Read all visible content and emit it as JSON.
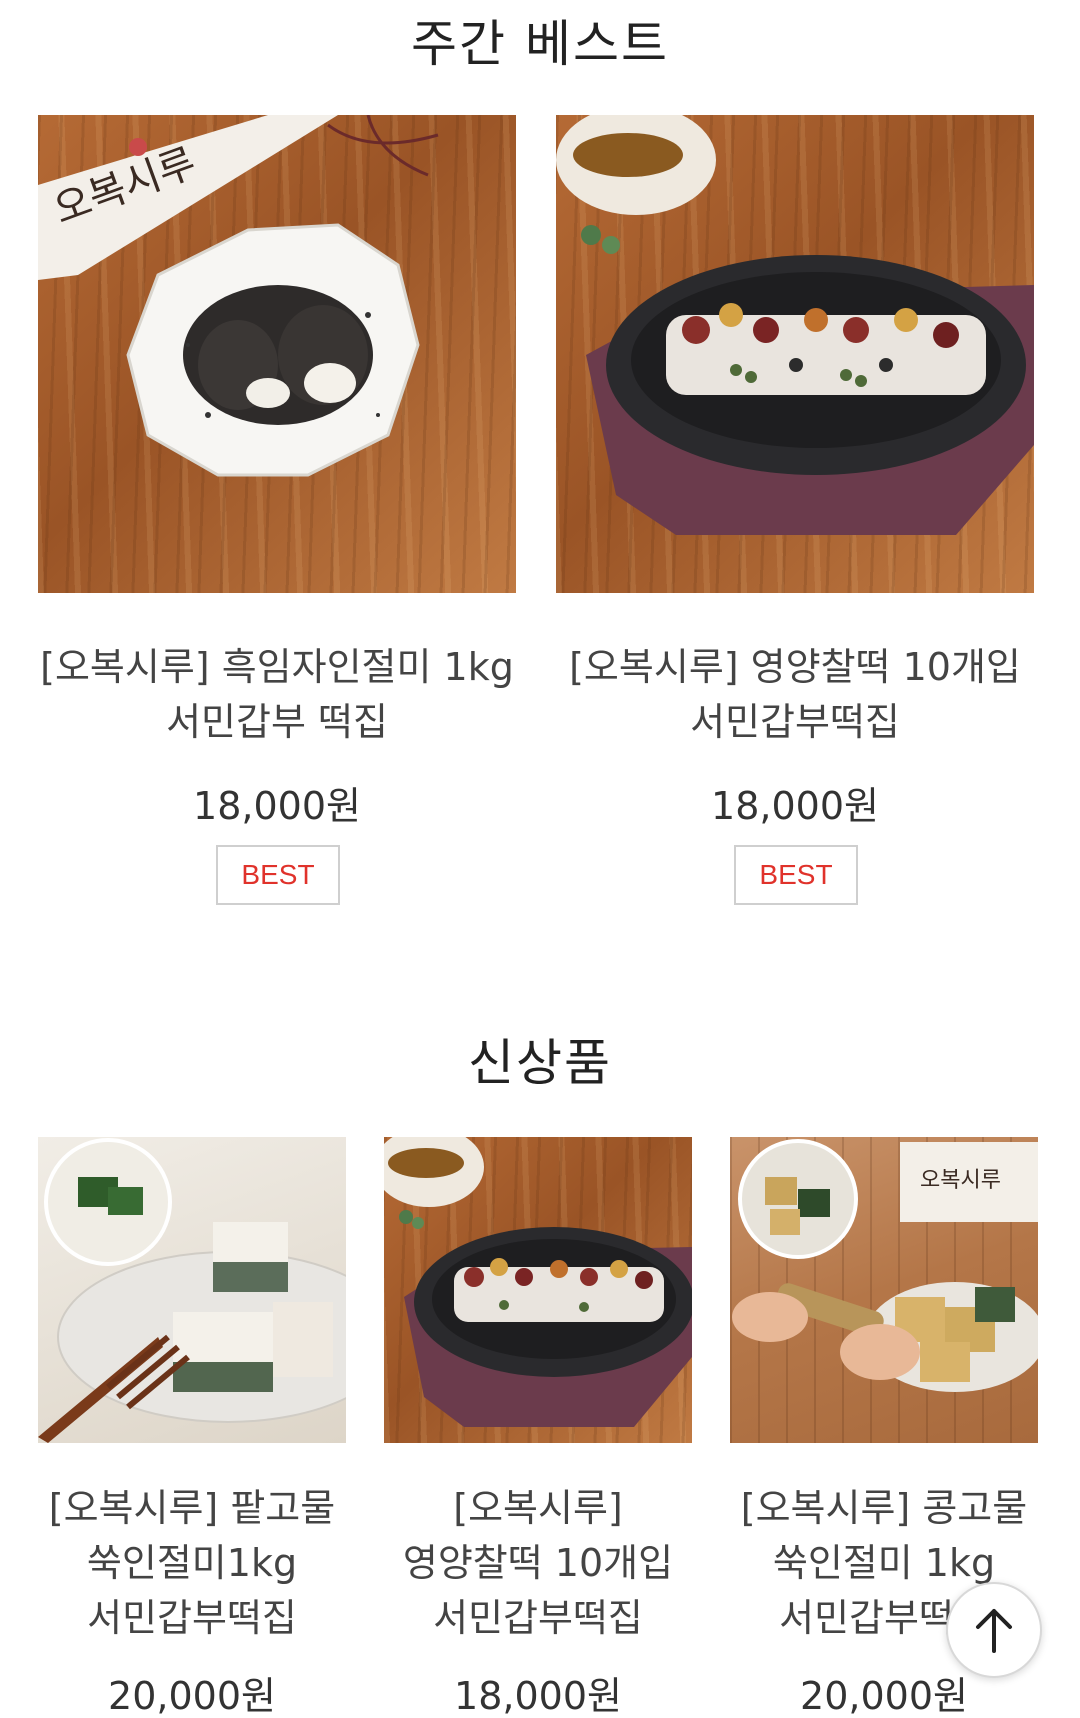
{
  "weekly_best": {
    "title": "주간 베스트",
    "items": [
      {
        "name_line1": "[오복시루] 흑임자인절미 1kg",
        "name_line2": "서민갑부 떡집",
        "price": "18,000원",
        "badge": "BEST"
      },
      {
        "name_line1": "[오복시루] 영양찰떡 10개입",
        "name_line2": "서민갑부떡집",
        "price": "18,000원",
        "badge": "BEST"
      }
    ]
  },
  "new_products": {
    "title": "신상품",
    "items": [
      {
        "name_line1": "[오복시루] 팥고물",
        "name_line2": "쑥인절미1kg",
        "name_line3": "서민갑부떡집",
        "price": "20,000원"
      },
      {
        "name_line1": "[오복시루]",
        "name_line2": "영양찰떡 10개입",
        "name_line3": "서민갑부떡집",
        "price": "18,000원"
      },
      {
        "name_line1": "[오복시루] 콩고물",
        "name_line2": "쑥인절미 1kg",
        "name_line3": "서민갑부떡집",
        "price": "20,000원"
      }
    ]
  },
  "images": {
    "logo_text": "오복시루"
  },
  "icons": {
    "scroll_top": "arrow-up-icon"
  }
}
